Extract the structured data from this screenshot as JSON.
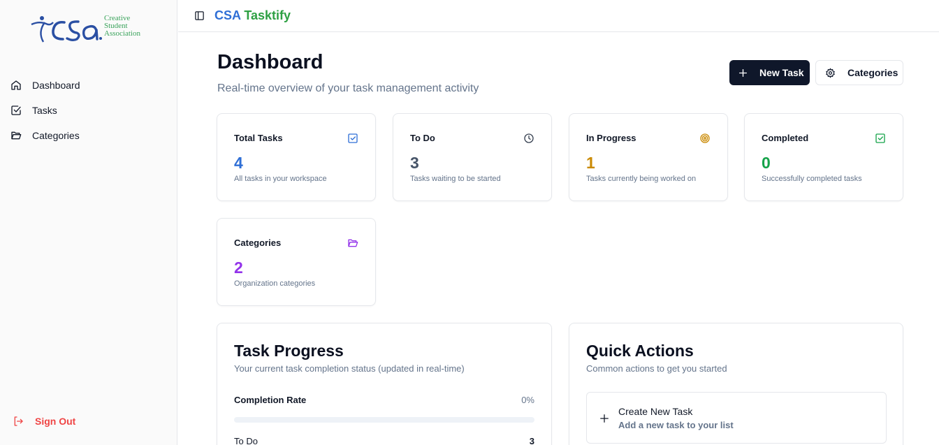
{
  "sidebar": {
    "logo": {
      "mark": "CSa",
      "line1": "Creative",
      "line2": "Student",
      "line3": "Association"
    },
    "items": [
      {
        "label": "Dashboard",
        "icon": "home-icon"
      },
      {
        "label": "Tasks",
        "icon": "check-square-icon"
      },
      {
        "label": "Categories",
        "icon": "folder-open-icon"
      }
    ],
    "sign_out": "Sign Out"
  },
  "topbar": {
    "brand_part1": "CSA",
    "brand_part2": "Tasktify"
  },
  "page": {
    "title": "Dashboard",
    "subtitle": "Real-time overview of your task management activity",
    "new_task_button": "New Task",
    "categories_button": "Categories"
  },
  "stats": [
    {
      "label": "Total Tasks",
      "value": "4",
      "desc": "All tasks in your workspace",
      "color": "#2f6fd6",
      "icon": "check-square-icon"
    },
    {
      "label": "To Do",
      "value": "3",
      "desc": "Tasks waiting to be started",
      "color": "#475569",
      "icon": "clock-icon"
    },
    {
      "label": "In Progress",
      "value": "1",
      "desc": "Tasks currently being worked on",
      "color": "#ca8a04",
      "icon": "target-icon"
    },
    {
      "label": "Completed",
      "value": "0",
      "desc": "Successfully completed tasks",
      "color": "#16a34a",
      "icon": "check-square-icon"
    },
    {
      "label": "Categories",
      "value": "2",
      "desc": "Organization categories",
      "color": "#9333ea",
      "icon": "folder-open-icon"
    }
  ],
  "progress": {
    "title": "Task Progress",
    "subtitle": "Your current task completion status (updated in real-time)",
    "rate_label": "Completion Rate",
    "rate_value": "0%",
    "rate_fraction": 0,
    "todo_label": "To Do",
    "todo_value": "3"
  },
  "quick_actions": {
    "title": "Quick Actions",
    "subtitle": "Common actions to get you started",
    "create_title": "Create New Task",
    "create_desc": "Add a new task to your list"
  }
}
